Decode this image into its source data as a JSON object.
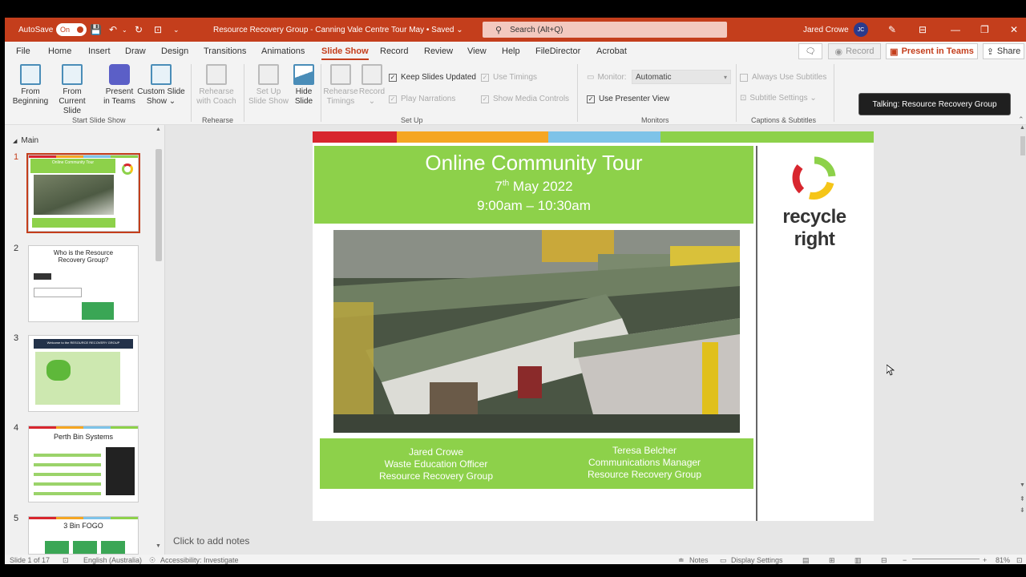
{
  "titlebar": {
    "autosave_label": "AutoSave",
    "autosave_state": "On",
    "document_title": "Resource Recovery Group - Canning Vale Centre Tour May • Saved",
    "title_chevron": "⌄",
    "search_placeholder": "Search (Alt+Q)",
    "user_name": "Jared Crowe",
    "user_initials": "JC"
  },
  "menu": {
    "tabs": [
      "File",
      "Home",
      "Insert",
      "Draw",
      "Design",
      "Transitions",
      "Animations",
      "Slide Show",
      "Record",
      "Review",
      "View",
      "Help",
      "FileDirector",
      "Acrobat"
    ],
    "active_tab": "Slide Show",
    "record_label": "Record",
    "present_label": "Present in Teams",
    "share_label": "Share"
  },
  "ribbon": {
    "from_beginning": [
      "From",
      "Beginning"
    ],
    "from_current": [
      "From",
      "Current Slide"
    ],
    "present_teams": [
      "Present",
      "in Teams"
    ],
    "custom_show": [
      "Custom Slide",
      "Show ⌄"
    ],
    "group_start": "Start Slide Show",
    "rehearse_coach": [
      "Rehearse",
      "with Coach"
    ],
    "group_rehearse": "Rehearse",
    "setup_show": [
      "Set Up",
      "Slide Show"
    ],
    "hide_slide": [
      "Hide",
      "Slide"
    ],
    "rehearse_timings": [
      "Rehearse",
      "Timings"
    ],
    "record_btn": [
      "Record",
      "⌄"
    ],
    "keep_updated": "Keep Slides Updated",
    "use_timings": "Use Timings",
    "play_narrations": "Play Narrations",
    "show_media": "Show Media Controls",
    "group_setup": "Set Up",
    "monitor_label": "Monitor:",
    "monitor_value": "Automatic",
    "presenter_view": "Use Presenter View",
    "group_monitors": "Monitors",
    "always_subtitles": "Always Use Subtitles",
    "subtitle_settings": "Subtitle Settings ⌄",
    "group_captions": "Captions & Subtitles"
  },
  "talking": "Talking: Resource Recovery Group",
  "thumbs": {
    "section": "Main",
    "items": [
      {
        "num": "1",
        "title": "Online Community Tour"
      },
      {
        "num": "2",
        "title": "Who is the Resource Recovery Group?"
      },
      {
        "num": "3",
        "title": "Welcome to the RESOURCE RECOVERY GROUP"
      },
      {
        "num": "4",
        "title": "Perth Bin Systems"
      },
      {
        "num": "5",
        "title": "3 Bin FOGO"
      }
    ]
  },
  "slide": {
    "title": "Online Community Tour",
    "date_day": "7",
    "date_sup": "th",
    "date_rest": " May 2022",
    "time": "9:00am – 10:30am",
    "speaker1": [
      "Jared Crowe",
      "Waste Education Officer",
      "Resource Recovery Group"
    ],
    "speaker2": [
      "Teresa Belcher",
      "Communications Manager",
      "Resource Recovery Group"
    ],
    "logo_line1": "recycle",
    "logo_line2": "right"
  },
  "notes_placeholder": "Click to add notes",
  "status": {
    "slide_count": "Slide 1 of 17",
    "language": "English (Australia)",
    "accessibility": "Accessibility: Investigate",
    "notes": "Notes",
    "display_settings": "Display Settings",
    "zoom": "81%"
  },
  "colors": {
    "accent": "#c43e1c",
    "slide_green": "#8dd14a"
  }
}
